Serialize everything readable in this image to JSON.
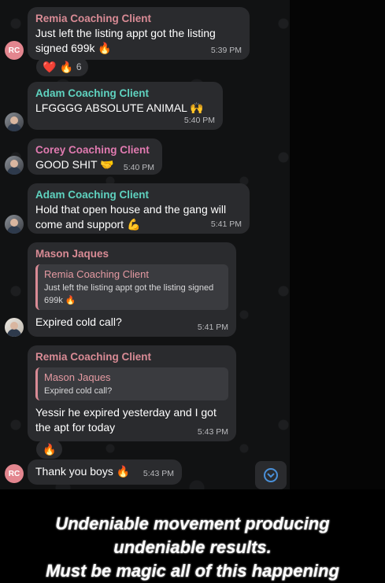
{
  "messages": [
    {
      "sender": "Remia Coaching Client",
      "sender_color": "#d98b95",
      "text_line1": "Just left the listing appt got the listing",
      "text_line2": "signed 699k 🔥",
      "time": "5:39 PM",
      "avatar_initials": "RC"
    },
    {
      "sender": "Adam Coaching Client",
      "sender_color": "#5fd3c0",
      "text": "LFGGGG ABSOLUTE ANIMAL 🙌",
      "time": "5:40 PM"
    },
    {
      "sender": "Corey Coaching Client",
      "sender_color": "#e07ab0",
      "text": "GOOD SHIT 🤝",
      "time": "5:40 PM"
    },
    {
      "sender": "Adam Coaching Client",
      "sender_color": "#5fd3c0",
      "text_line1": "Hold that open house and the gang will",
      "text_line2": "come and support 💪",
      "time": "5:41 PM"
    },
    {
      "sender": "Mason Jaques",
      "sender_color": "#d98b95",
      "quote_name": "Remia Coaching Client",
      "quote_line1": "Just left the listing appt got the listing signed",
      "quote_line2": "699k 🔥",
      "text": "Expired cold call?",
      "time": "5:41 PM"
    },
    {
      "sender": "Remia Coaching Client",
      "sender_color": "#d98b95",
      "quote_name": "Mason Jaques",
      "quote_line1": "Expired cold call?",
      "text_line1": "Yessir he expired yesterday and I got",
      "text_line2": "the apt for today",
      "time": "5:43 PM"
    },
    {
      "text": "Thank you boys 🔥",
      "time": "5:43 PM",
      "avatar_initials": "RC"
    }
  ],
  "reactions": {
    "first": {
      "emoji1": "❤️",
      "emoji2": "🔥",
      "count": "6"
    },
    "second": {
      "emoji1": "🔥"
    }
  },
  "caption": {
    "line1": "Undeniable movement producing",
    "line2": "undeniable results.",
    "line3": "Must be magic all of this happening"
  }
}
